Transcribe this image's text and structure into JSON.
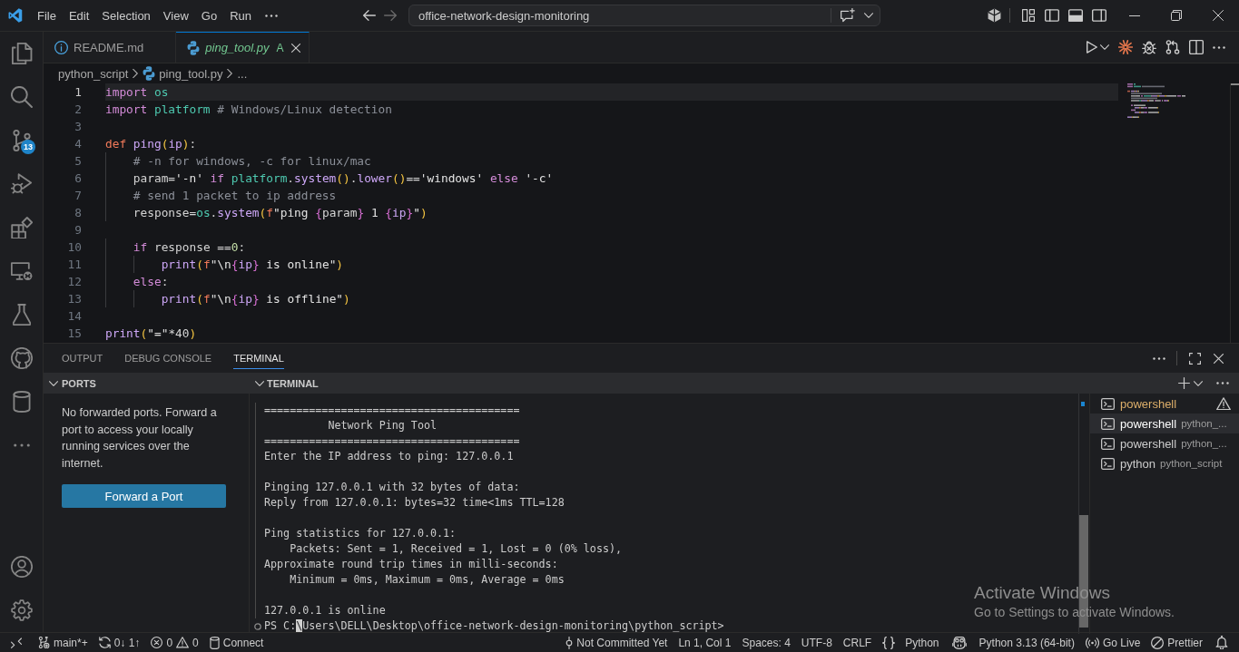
{
  "title_bar": {
    "menu": [
      "File",
      "Edit",
      "Selection",
      "View",
      "Go",
      "Run"
    ],
    "command_center": "office-network-design-monitoring",
    "layout": {
      "primary_sidebar": false,
      "panel": true,
      "secondary_sidebar": false
    }
  },
  "activity_bar": {
    "source_control_badge": "13"
  },
  "editor": {
    "tabs": [
      {
        "label": "README.md",
        "kind": "markdown",
        "selected": false,
        "preview": false
      },
      {
        "label": "ping_tool.py",
        "kind": "python",
        "selected": true,
        "preview": true,
        "git_status": "A"
      }
    ],
    "breadcrumbs": [
      {
        "label": "python_script",
        "kind": "folder"
      },
      {
        "label": "ping_tool.py",
        "kind": "python"
      },
      {
        "label": "...",
        "kind": "symbol"
      }
    ],
    "lines": [
      {
        "number": "1",
        "current": true,
        "tokens": [
          {
            "kind": "keyword",
            "text": "import "
          },
          {
            "kind": "module",
            "text": "os"
          }
        ]
      },
      {
        "number": "2",
        "current": false,
        "tokens": [
          {
            "kind": "keyword",
            "text": "import "
          },
          {
            "kind": "module",
            "text": "platform "
          },
          {
            "kind": "comment",
            "text": "# Windows/Linux detection"
          }
        ]
      },
      {
        "number": "3",
        "current": false
      },
      {
        "number": "4",
        "current": false,
        "tokens": [
          {
            "kind": "storage",
            "text": "def "
          },
          {
            "kind": "function",
            "text": "ping"
          },
          {
            "kind": "bracket",
            "text": "("
          },
          {
            "kind": "variable",
            "text": "ip"
          },
          {
            "kind": "bracket",
            "text": ")"
          },
          {
            "kind": "plain",
            "text": ":"
          }
        ]
      },
      {
        "number": "5",
        "current": false,
        "tokens": [
          {
            "kind": "comment",
            "text": "    # -n for windows, -c for linux/mac"
          }
        ]
      },
      {
        "number": "6",
        "current": false,
        "tokens": [
          {
            "kind": "plain",
            "text": "    param="
          },
          {
            "kind": "string",
            "text": "'-n' "
          },
          {
            "kind": "keyword",
            "text": "if "
          },
          {
            "kind": "module",
            "text": "platform"
          },
          {
            "kind": "plain",
            "text": "."
          },
          {
            "kind": "function",
            "text": "system"
          },
          {
            "kind": "bracket",
            "text": "()"
          },
          {
            "kind": "plain",
            "text": "."
          },
          {
            "kind": "function",
            "text": "lower"
          },
          {
            "kind": "bracket",
            "text": "()"
          },
          {
            "kind": "plain",
            "text": "=="
          },
          {
            "kind": "string",
            "text": "'windows' "
          },
          {
            "kind": "keyword",
            "text": "else "
          },
          {
            "kind": "string",
            "text": "'-c'"
          }
        ]
      },
      {
        "number": "7",
        "current": false,
        "tokens": [
          {
            "kind": "comment",
            "text": "    # send 1 packet to ip address"
          }
        ]
      },
      {
        "number": "8",
        "current": false,
        "tokens": [
          {
            "kind": "plain",
            "text": "    response="
          },
          {
            "kind": "module",
            "text": "os"
          },
          {
            "kind": "plain",
            "text": "."
          },
          {
            "kind": "function",
            "text": "system"
          },
          {
            "kind": "bracket",
            "text": "("
          },
          {
            "kind": "prefix",
            "text": "f"
          },
          {
            "kind": "string",
            "text": "\"ping "
          },
          {
            "kind": "interpolation",
            "text": "{"
          },
          {
            "kind": "plain",
            "text": "param"
          },
          {
            "kind": "interpolation",
            "text": "}"
          },
          {
            "kind": "string",
            "text": " 1 "
          },
          {
            "kind": "interpolation",
            "text": "{"
          },
          {
            "kind": "variable",
            "text": "ip"
          },
          {
            "kind": "interpolation",
            "text": "}"
          },
          {
            "kind": "string",
            "text": "\""
          },
          {
            "kind": "bracket",
            "text": ")"
          }
        ]
      },
      {
        "number": "9",
        "current": false
      },
      {
        "number": "10",
        "current": false,
        "tokens": [
          {
            "kind": "keyword",
            "text": "    if "
          },
          {
            "kind": "plain",
            "text": "response =="
          },
          {
            "kind": "number",
            "text": "0"
          },
          {
            "kind": "plain",
            "text": ":"
          }
        ]
      },
      {
        "number": "11",
        "current": false,
        "tokens": [
          {
            "kind": "function",
            "text": "        print"
          },
          {
            "kind": "bracket",
            "text": "("
          },
          {
            "kind": "prefix",
            "text": "f"
          },
          {
            "kind": "string",
            "text": "\"\\n"
          },
          {
            "kind": "interpolation",
            "text": "{"
          },
          {
            "kind": "variable",
            "text": "ip"
          },
          {
            "kind": "interpolation",
            "text": "}"
          },
          {
            "kind": "string",
            "text": " is online\""
          },
          {
            "kind": "bracket",
            "text": ")"
          }
        ]
      },
      {
        "number": "12",
        "current": false,
        "tokens": [
          {
            "kind": "keyword",
            "text": "    else"
          },
          {
            "kind": "plain",
            "text": ":"
          }
        ]
      },
      {
        "number": "13",
        "current": false,
        "tokens": [
          {
            "kind": "function",
            "text": "        print"
          },
          {
            "kind": "bracket",
            "text": "("
          },
          {
            "kind": "prefix",
            "text": "f"
          },
          {
            "kind": "string",
            "text": "\"\\n"
          },
          {
            "kind": "interpolation",
            "text": "{"
          },
          {
            "kind": "variable",
            "text": "ip"
          },
          {
            "kind": "interpolation",
            "text": "}"
          },
          {
            "kind": "string",
            "text": " is offline\""
          },
          {
            "kind": "bracket",
            "text": ")"
          }
        ]
      },
      {
        "number": "14",
        "current": false
      },
      {
        "number": "15",
        "current": false,
        "tokens": [
          {
            "kind": "function",
            "text": "print"
          },
          {
            "kind": "bracket",
            "text": "("
          },
          {
            "kind": "string",
            "text": "\"=\""
          },
          {
            "kind": "plain",
            "text": "*40"
          },
          {
            "kind": "bracket",
            "text": ")"
          }
        ]
      }
    ]
  },
  "panel": {
    "tabs": [
      {
        "label": "OUTPUT",
        "selected": false
      },
      {
        "label": "DEBUG CONSOLE",
        "selected": false
      },
      {
        "label": "TERMINAL",
        "selected": true
      }
    ],
    "ports": {
      "title": "PORTS",
      "expanded": true,
      "message": "No forwarded ports. Forward a port to access your locally running services over the internet.",
      "button": "Forward a Port"
    },
    "terminal": {
      "title": "TERMINAL",
      "expanded": true,
      "output_blocks": [
        [
          "========================================",
          "          Network Ping Tool",
          "========================================",
          "Enter the IP address to ping: 127.0.0.1"
        ],
        [
          "Pinging 127.0.0.1 with 32 bytes of data:",
          "Reply from 127.0.0.1: bytes=32 time<1ms TTL=128"
        ],
        [
          "Ping statistics for 127.0.0.1:",
          "    Packets: Sent = 1, Received = 1, Lost = 0 (0% loss),",
          "Approximate round trip times in milli-seconds:",
          "    Minimum = 0ms, Maximum = 0ms, Average = 0ms"
        ],
        [
          "127.0.0.1 is online"
        ]
      ],
      "prompt": {
        "before_cursor": "PS C:",
        "at_cursor": "\\",
        "after_cursor": "Users\\DELL\\Desktop\\office-network-design-monitoring\\python_script>"
      },
      "sessions": [
        {
          "name": "powershell",
          "warning": true,
          "selected": false
        },
        {
          "name": "powershell",
          "description": "python_...",
          "warning": false,
          "selected": true
        },
        {
          "name": "powershell",
          "description": "python_...",
          "warning": false,
          "selected": false
        },
        {
          "name": "python",
          "description": "python_script",
          "warning": false,
          "selected": false
        }
      ]
    }
  },
  "status_bar": {
    "left": [
      {
        "kind": "branch",
        "text": "main*+"
      },
      {
        "kind": "sync",
        "text": "0↓ 1↑"
      },
      {
        "kind": "problems",
        "errors": "0",
        "warnings": "0"
      },
      {
        "kind": "database",
        "text": "Connect"
      }
    ],
    "right": [
      {
        "kind": "blame",
        "text": "Not Committed Yet"
      },
      {
        "kind": "plain",
        "text": "Ln 1, Col 1"
      },
      {
        "kind": "plain",
        "text": "Spaces: 4"
      },
      {
        "kind": "plain",
        "text": "UTF-8"
      },
      {
        "kind": "plain",
        "text": "CRLF"
      },
      {
        "kind": "language",
        "text": "Python"
      },
      {
        "kind": "assistant"
      },
      {
        "kind": "plain",
        "text": "Python 3.13 (64-bit)"
      },
      {
        "kind": "live",
        "text": "Go Live"
      },
      {
        "kind": "formatter",
        "text": "Prettier"
      },
      {
        "kind": "notifications"
      }
    ]
  },
  "system_notice": {
    "title": "Activate Windows",
    "subtitle": "Go to Settings to activate Windows."
  }
}
